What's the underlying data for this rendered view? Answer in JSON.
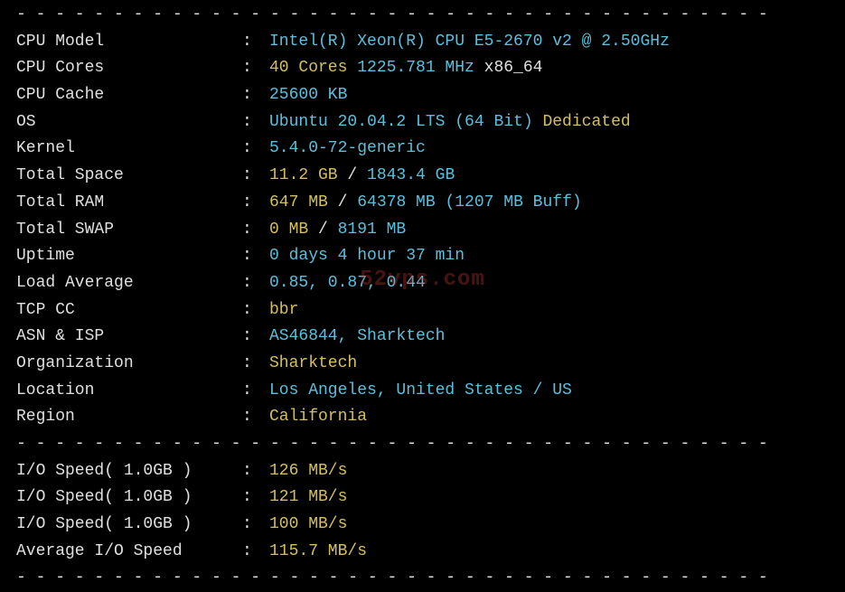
{
  "divider": "- - - - - - - - - - - - - - - - - - - - - - - - - - - - - - - - - - - - - - -",
  "watermark": "52vps.com",
  "rows": [
    {
      "label": "CPU Model",
      "segments": [
        {
          "text": "Intel(R) Xeon(R) CPU E5-2670 v2 @ 2.50GHz",
          "class": "cyan"
        }
      ]
    },
    {
      "label": "CPU Cores",
      "segments": [
        {
          "text": "40 Cores ",
          "class": "yellow"
        },
        {
          "text": "1225.781 MHz ",
          "class": "cyan"
        },
        {
          "text": "x86_64",
          "class": "white"
        }
      ]
    },
    {
      "label": "CPU Cache",
      "segments": [
        {
          "text": "25600 KB",
          "class": "cyan"
        }
      ]
    },
    {
      "label": "OS",
      "segments": [
        {
          "text": "Ubuntu 20.04.2 LTS (64 Bit) ",
          "class": "cyan"
        },
        {
          "text": "Dedicated",
          "class": "yellow"
        }
      ]
    },
    {
      "label": "Kernel",
      "segments": [
        {
          "text": "5.4.0-72-generic",
          "class": "cyan"
        }
      ]
    },
    {
      "label": "Total Space",
      "segments": [
        {
          "text": "11.2 GB ",
          "class": "yellow"
        },
        {
          "text": "/ ",
          "class": "white"
        },
        {
          "text": "1843.4 GB",
          "class": "cyan"
        }
      ]
    },
    {
      "label": "Total RAM",
      "segments": [
        {
          "text": "647 MB ",
          "class": "yellow"
        },
        {
          "text": "/ ",
          "class": "white"
        },
        {
          "text": "64378 MB ",
          "class": "cyan"
        },
        {
          "text": "(1207 MB Buff)",
          "class": "cyan"
        }
      ]
    },
    {
      "label": "Total SWAP",
      "segments": [
        {
          "text": "0 MB ",
          "class": "yellow"
        },
        {
          "text": "/ ",
          "class": "white"
        },
        {
          "text": "8191 MB",
          "class": "cyan"
        }
      ]
    },
    {
      "label": "Uptime",
      "segments": [
        {
          "text": "0 days 4 hour 37 min",
          "class": "cyan"
        }
      ]
    },
    {
      "label": "Load Average",
      "segments": [
        {
          "text": "0.85, 0.87, 0.44",
          "class": "cyan"
        }
      ]
    },
    {
      "label": "TCP CC",
      "segments": [
        {
          "text": "bbr",
          "class": "yellow"
        }
      ]
    },
    {
      "label": "ASN & ISP",
      "segments": [
        {
          "text": "AS46844, Sharktech",
          "class": "cyan"
        }
      ]
    },
    {
      "label": "Organization",
      "segments": [
        {
          "text": "Sharktech",
          "class": "yellow"
        }
      ]
    },
    {
      "label": "Location",
      "segments": [
        {
          "text": "Los Angeles, United States / US",
          "class": "cyan"
        }
      ]
    },
    {
      "label": "Region",
      "segments": [
        {
          "text": "California",
          "class": "yellow"
        }
      ]
    }
  ],
  "io_rows": [
    {
      "label": "I/O Speed( 1.0GB )",
      "value": "126 MB/s"
    },
    {
      "label": "I/O Speed( 1.0GB )",
      "value": "121 MB/s"
    },
    {
      "label": "I/O Speed( 1.0GB )",
      "value": "100 MB/s"
    },
    {
      "label": "Average I/O Speed",
      "value": "115.7 MB/s"
    }
  ]
}
